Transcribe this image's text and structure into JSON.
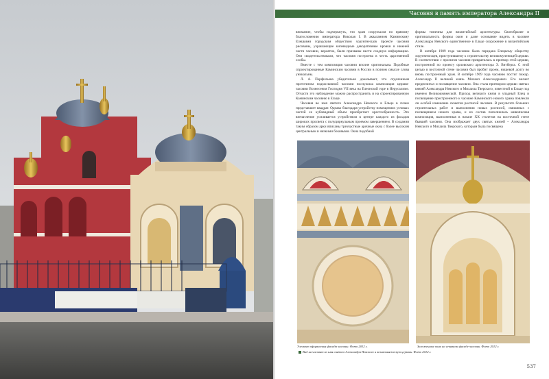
{
  "header": {
    "title": "Часовня в память императора Александра II"
  },
  "page_number": "537",
  "left_column": [
    "внимание, чтобы подчеркнуть, что храм сооружался по прямому благословению императора Николая I. В акваланном Каминскому Елецкими городским обществом хорунгнесцов проекте часовни рисованы, украшающие килевидные декоративные кровки в нижней части часовни, вероятно, были призваны нести сходную информацию. Они свидетельствовали, что часовня построена в честь царственной особы.",
    "Вместе с тем композиция часовни вполне оригинальна. Подобные спроектированные Каминским часовни в России в полном смысле слова уникальны.",
    "Л. А. Перфильева убедительно доказывает, что отдаленным прототипом подмосковной часовни послужила композиция церкви-часовни Вознесения Господня VII века на Елеонской горе в Иерусалиме. Отчасти это наблюдение можно распространить и на спроектированную Каминским часовню в Ельце.",
    "Часовня во имя святого Александра Невского в Ельце в плане представляет квадрат. Однако благодаря устройству помещениях угловых частей ее кубовидный объем приобретает крестообразность. Это впечатление усиливается устройством в центре каждого из фасадов широких просвета с полуциркульным проемом завершением. В создании таким образом арки вписаны трехчастные арочные окна с более высоким центральным и низкими боковыми. Окна подобной"
  ],
  "right_column": [
    "формы типичны для византийской архитектуры. Своеобразие и оригинальность формы окон и даже основание видеть в часовне Александра Невского единственное в Ельце сооружение в византийском стиле.",
    "В октябре 1909 года часовню была передана Елецкому обществу хоругвеносцев, приступившему к строительству великомученицей церкви. В соответствии с проектом часовня превратилась в притвор этой церкви, построенной по проекту орловского архитектора Э. Витберга. С этой целью в восточной стене часовни был пробит проем, нишевой долгу во вновь построенный храм. В октябре 1909 года часовню постиг пожар. Александр II великий князь Михаил Александрович. Его вилает предпочитал и посвящение часовни. Она стала притвором церкви святых князей Александра Невского и Михаила Тверского, известной в Ельце под именем Великокняжеской. Приход великого князя в упадный Елец и посвящение пристроенного к часовне Каминского нового храма повлекли ли особой изменение сюжетов росписей часовни. В результате больших строительных работ и выполнения новых росписей, связанных с посвящением нового храма, и их состав пополнилась живописная композиция, выполненная в начале XX столетия на восточной стене бывшей часовни. Она изображает двух святых князей – Александра Невского и Михаила Тверского, которым была посвящена"
  ],
  "captions": {
    "left_photo": "Вид на часовню во имя святого Александра Невского и великокняжескую церковь. Фото 2012 г.",
    "detail_one": "Элемент оформления фасада часовни. Фото 2012 г.",
    "detail_two": "Заложенные окна на северном фасаде часовни. Фото 2012 г."
  },
  "colors": {
    "header_green": "#3f7d45",
    "brick_red": "#b3383e",
    "dome_blue": "#5d6d86",
    "cream": "#e8d7b4",
    "gold": "#c9a23c"
  }
}
